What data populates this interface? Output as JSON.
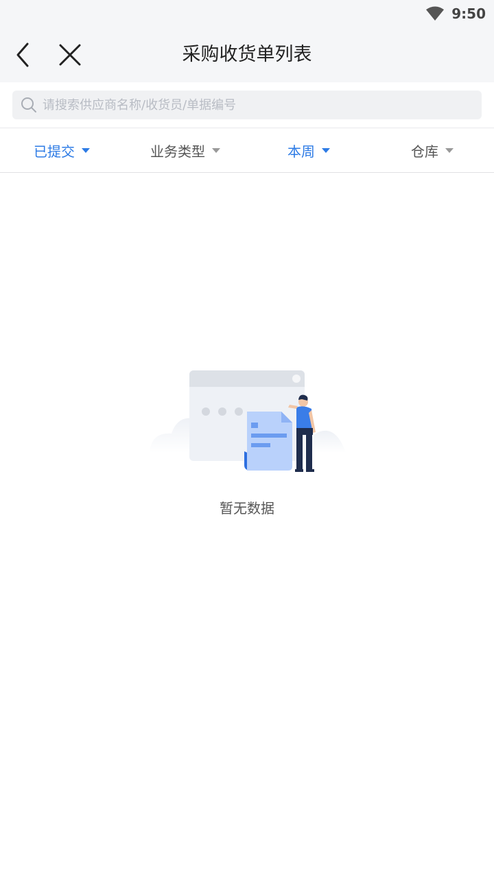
{
  "status_bar": {
    "time": "9:50",
    "wifi_icon": "wifi-icon"
  },
  "nav": {
    "title": "采购收货单列表",
    "back_icon": "chevron-left-icon",
    "close_icon": "close-icon"
  },
  "search": {
    "placeholder": "请搜索供应商名称/收货员/单据编号",
    "value": ""
  },
  "filters": [
    {
      "label": "已提交",
      "active": true
    },
    {
      "label": "业务类型",
      "active": false
    },
    {
      "label": "本周",
      "active": true
    },
    {
      "label": "仓库",
      "active": false
    }
  ],
  "empty_state": {
    "message": "暂无数据"
  },
  "colors": {
    "accent": "#2d7be5",
    "nav_bg": "#f5f6f8",
    "text": "#222222"
  }
}
